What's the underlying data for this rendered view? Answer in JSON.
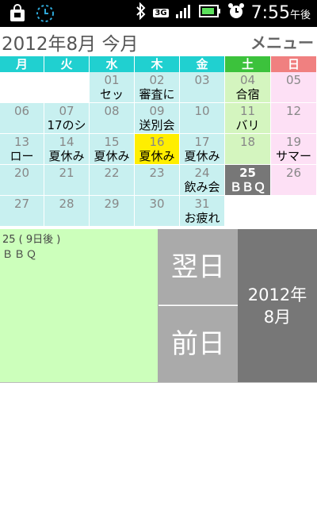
{
  "status": {
    "time": "7:55",
    "ampm": "午後",
    "network": "3G"
  },
  "header": {
    "title": "2012年8月 今月",
    "menu_label": "メニュー"
  },
  "weekdays": [
    "月",
    "火",
    "水",
    "木",
    "金",
    "土",
    "日"
  ],
  "weekday_colors": [
    "#20d0d0",
    "#20d0d0",
    "#20d0d0",
    "#20d0d0",
    "#20d0d0",
    "#3cc23c",
    "#f08080"
  ],
  "calendar": {
    "rows": [
      [
        {
          "num": "",
          "evt": "",
          "type": "empty"
        },
        {
          "num": "",
          "evt": "",
          "type": "empty"
        },
        {
          "num": "01",
          "evt": "セッ",
          "type": "weekday"
        },
        {
          "num": "02",
          "evt": "審査に",
          "type": "weekday"
        },
        {
          "num": "03",
          "evt": "",
          "type": "weekday"
        },
        {
          "num": "04",
          "evt": "合宿",
          "type": "sat"
        },
        {
          "num": "05",
          "evt": "",
          "type": "sun"
        }
      ],
      [
        {
          "num": "06",
          "evt": "",
          "type": "weekday"
        },
        {
          "num": "07",
          "evt": "17のシ",
          "type": "weekday"
        },
        {
          "num": "08",
          "evt": "",
          "type": "weekday"
        },
        {
          "num": "09",
          "evt": "送別会",
          "type": "weekday"
        },
        {
          "num": "10",
          "evt": "",
          "type": "weekday"
        },
        {
          "num": "11",
          "evt": "バリ",
          "type": "sat"
        },
        {
          "num": "12",
          "evt": "",
          "type": "sun"
        }
      ],
      [
        {
          "num": "13",
          "evt": "ロー",
          "type": "weekday"
        },
        {
          "num": "14",
          "evt": "夏休み",
          "type": "weekday"
        },
        {
          "num": "15",
          "evt": "夏休み",
          "type": "weekday"
        },
        {
          "num": "16",
          "evt": "夏休み",
          "type": "today"
        },
        {
          "num": "17",
          "evt": "夏休み",
          "type": "weekday"
        },
        {
          "num": "18",
          "evt": "",
          "type": "sat"
        },
        {
          "num": "19",
          "evt": "サマー",
          "type": "sun"
        }
      ],
      [
        {
          "num": "20",
          "evt": "",
          "type": "weekday"
        },
        {
          "num": "21",
          "evt": "",
          "type": "weekday"
        },
        {
          "num": "22",
          "evt": "",
          "type": "weekday"
        },
        {
          "num": "23",
          "evt": "",
          "type": "weekday"
        },
        {
          "num": "24",
          "evt": "飲み会",
          "type": "weekday"
        },
        {
          "num": "25",
          "evt": "ＢＢＱ",
          "type": "selected"
        },
        {
          "num": "26",
          "evt": "",
          "type": "sun"
        }
      ],
      [
        {
          "num": "27",
          "evt": "",
          "type": "weekday"
        },
        {
          "num": "28",
          "evt": "",
          "type": "weekday"
        },
        {
          "num": "29",
          "evt": "",
          "type": "weekday"
        },
        {
          "num": "30",
          "evt": "",
          "type": "weekday"
        },
        {
          "num": "31",
          "evt": "お疲れ",
          "type": "weekday"
        },
        {
          "num": "",
          "evt": "",
          "type": "empty"
        },
        {
          "num": "",
          "evt": "",
          "type": "empty"
        }
      ]
    ]
  },
  "detail": {
    "date_label": "25 ( 9日後 )",
    "text": "ＢＢＱ"
  },
  "buttons": {
    "next": "翌日",
    "prev": "前日"
  },
  "month_box": {
    "line1": "2012年",
    "line2": "8月"
  }
}
